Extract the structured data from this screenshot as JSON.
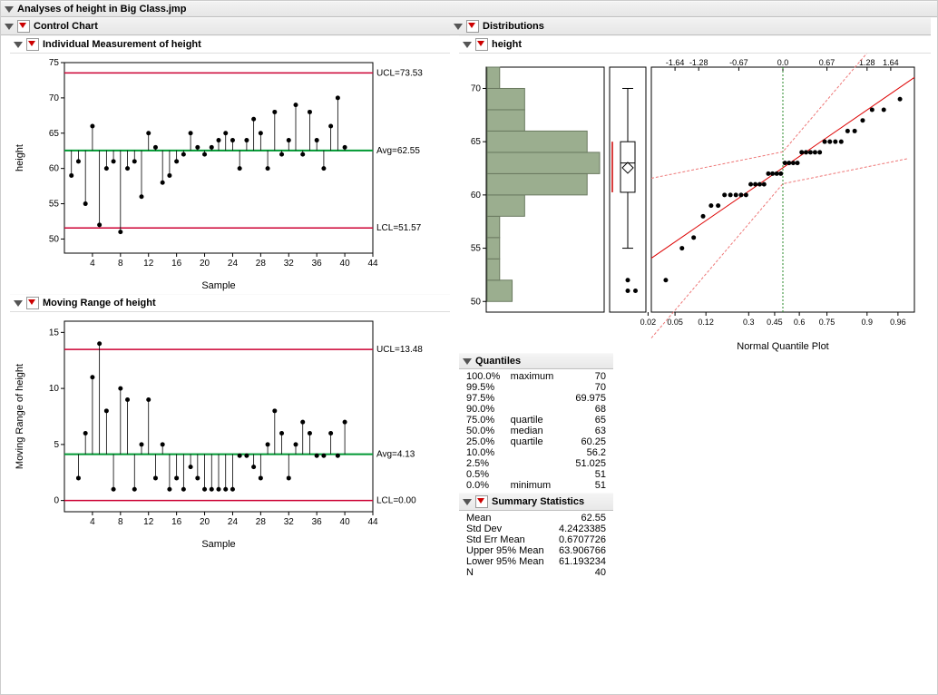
{
  "title": "Analyses of height in Big Class.jmp",
  "left": {
    "control_chart": "Control Chart",
    "individual": "Individual Measurement of height",
    "moving_range": "Moving Range of height"
  },
  "right": {
    "distributions": "Distributions",
    "height": "height",
    "normal_quantile": "Normal Quantile Plot",
    "quantiles_header": "Quantiles",
    "summary_header": "Summary Statistics"
  },
  "ccLabels": {
    "ucl": "UCL=73.53",
    "avg": "Avg=62.55",
    "lcl": "LCL=51.57",
    "mr_ucl": "UCL=13.48",
    "mr_avg": "Avg=4.13",
    "mr_lcl": "LCL=0.00",
    "ylab_individual": "height",
    "ylab_mr": "Moving Range of height",
    "xlab": "Sample"
  },
  "quantiles": [
    {
      "pct": "100.0%",
      "label": "maximum",
      "val": "70"
    },
    {
      "pct": "99.5%",
      "label": "",
      "val": "70"
    },
    {
      "pct": "97.5%",
      "label": "",
      "val": "69.975"
    },
    {
      "pct": "90.0%",
      "label": "",
      "val": "68"
    },
    {
      "pct": "75.0%",
      "label": "quartile",
      "val": "65"
    },
    {
      "pct": "50.0%",
      "label": "median",
      "val": "63"
    },
    {
      "pct": "25.0%",
      "label": "quartile",
      "val": "60.25"
    },
    {
      "pct": "10.0%",
      "label": "",
      "val": "56.2"
    },
    {
      "pct": "2.5%",
      "label": "",
      "val": "51.025"
    },
    {
      "pct": "0.5%",
      "label": "",
      "val": "51"
    },
    {
      "pct": "0.0%",
      "label": "minimum",
      "val": "51"
    }
  ],
  "summary": [
    {
      "k": "Mean",
      "v": "62.55"
    },
    {
      "k": "Std Dev",
      "v": "4.2423385"
    },
    {
      "k": "Std Err Mean",
      "v": "0.6707726"
    },
    {
      "k": "Upper 95% Mean",
      "v": "63.906766"
    },
    {
      "k": "Lower 95% Mean",
      "v": "61.193234"
    },
    {
      "k": "N",
      "v": "40"
    }
  ],
  "chart_data": {
    "individual": {
      "type": "control-chart",
      "xlabel": "Sample",
      "ylabel": "height",
      "ylim": [
        48,
        75
      ],
      "xlim": [
        0,
        44
      ],
      "xticks": [
        4,
        8,
        12,
        16,
        20,
        24,
        28,
        32,
        36,
        40,
        44
      ],
      "yticks": [
        50,
        55,
        60,
        65,
        70,
        75
      ],
      "ucl": 73.53,
      "avg": 62.55,
      "lcl": 51.57,
      "values": [
        59,
        61,
        55,
        66,
        52,
        60,
        61,
        51,
        60,
        61,
        56,
        65,
        63,
        58,
        59,
        61,
        62,
        65,
        63,
        62,
        63,
        64,
        65,
        64,
        60,
        64,
        67,
        65,
        60,
        68,
        62,
        64,
        69,
        62,
        68,
        64,
        60,
        66,
        70,
        63
      ]
    },
    "moving_range": {
      "type": "control-chart",
      "xlabel": "Sample",
      "ylabel": "Moving Range of height",
      "ylim": [
        -1,
        16
      ],
      "xlim": [
        0,
        44
      ],
      "xticks": [
        4,
        8,
        12,
        16,
        20,
        24,
        28,
        32,
        36,
        40,
        44
      ],
      "yticks": [
        0,
        5,
        10,
        15
      ],
      "ucl": 13.48,
      "avg": 4.13,
      "lcl": 0.0,
      "values": [
        null,
        2,
        6,
        11,
        14,
        8,
        1,
        10,
        9,
        1,
        5,
        9,
        2,
        5,
        1,
        2,
        1,
        3,
        2,
        1,
        1,
        1,
        1,
        1,
        4,
        4,
        3,
        2,
        5,
        8,
        6,
        2,
        5,
        7,
        6,
        4,
        4,
        6,
        4,
        7
      ]
    },
    "histogram": {
      "type": "histogram-boxplot-normal-quantile",
      "y_range": [
        49,
        72
      ],
      "bins": [
        {
          "low": 50,
          "high": 52,
          "count": 2
        },
        {
          "low": 52,
          "high": 54,
          "count": 1
        },
        {
          "low": 54,
          "high": 56,
          "count": 1
        },
        {
          "low": 56,
          "high": 58,
          "count": 1
        },
        {
          "low": 58,
          "high": 60,
          "count": 3
        },
        {
          "low": 60,
          "high": 62,
          "count": 8
        },
        {
          "low": 62,
          "high": 64,
          "count": 9
        },
        {
          "low": 64,
          "high": 66,
          "count": 8
        },
        {
          "low": 66,
          "high": 68,
          "count": 3
        },
        {
          "low": 68,
          "high": 70,
          "count": 3
        },
        {
          "low": 70,
          "high": 72,
          "count": 1
        }
      ],
      "boxplot": {
        "min": 55,
        "q1": 60.25,
        "median": 63,
        "q3": 65,
        "max": 70,
        "outliers": [
          51,
          52
        ],
        "mean": 62.55
      },
      "qq_xticks_top": [
        "-1.64",
        "-1.28",
        "-0.67",
        "0.0",
        "0.67",
        "1.28",
        "1.64"
      ],
      "qq_xticks_bottom": [
        "0.02",
        "0.05",
        "0.12",
        "0.3",
        "0.45",
        "0.6",
        "0.75",
        "0.9",
        "0.96"
      ]
    }
  }
}
